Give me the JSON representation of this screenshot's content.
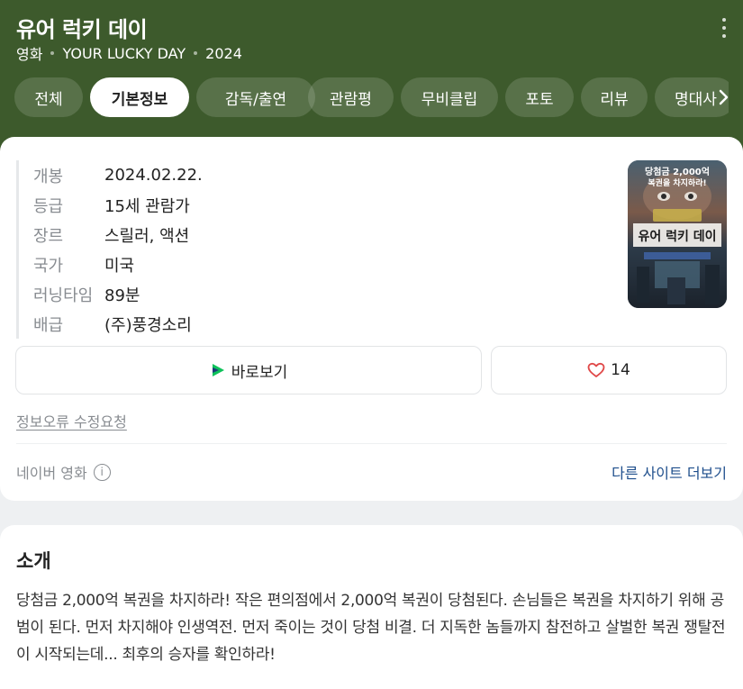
{
  "header": {
    "title": "유어 럭키 데이",
    "category": "영화",
    "english_title": "YOUR LUCKY DAY",
    "year": "2024"
  },
  "tabs": [
    {
      "label": "전체",
      "active": false
    },
    {
      "label": "기본정보",
      "active": true
    },
    {
      "label": "감독/출연",
      "active": false
    },
    {
      "label": "관람평",
      "active": false
    },
    {
      "label": "무비클립",
      "active": false
    },
    {
      "label": "포토",
      "active": false
    },
    {
      "label": "리뷰",
      "active": false
    },
    {
      "label": "명대사",
      "active": false
    }
  ],
  "info": [
    {
      "label": "개봉",
      "value": "2024.02.22."
    },
    {
      "label": "등급",
      "value": "15세 관람가"
    },
    {
      "label": "장르",
      "value": "스릴러, 액션"
    },
    {
      "label": "국가",
      "value": "미국"
    },
    {
      "label": "러닝타임",
      "value": "89분"
    },
    {
      "label": "배급",
      "value": "(주)풍경소리"
    }
  ],
  "poster": {
    "top_text_1": "당첨금 2,000억",
    "top_text_2": "복권을 차지하라!",
    "title": "유어 럭키 데이"
  },
  "actions": {
    "watch_label": "바로보기",
    "like_count": "14"
  },
  "report_link": "정보오류 수정요청",
  "source": {
    "label": "네이버 영화",
    "more_sites": "다른 사이트 더보기"
  },
  "intro": {
    "title": "소개",
    "text": "당첨금 2,000억 복권을 차지하라! 작은 편의점에서 2,000억 복권이 당첨된다. 손님들은 복권을 차지하기 위해 공범이 된다. 먼저 차지해야 인생역전. 먼저 죽이는 것이 당첨 비결. 더 지독한 놈들까지 참전하고 살벌한 복권 쟁탈전이 시작되는데... 최후의 승자를 확인하라!"
  },
  "colors": {
    "header_bg": "#3d5a2c",
    "link_blue": "#1e4e8c",
    "heart_red": "#e04848",
    "play_green": "#0ec25a"
  }
}
